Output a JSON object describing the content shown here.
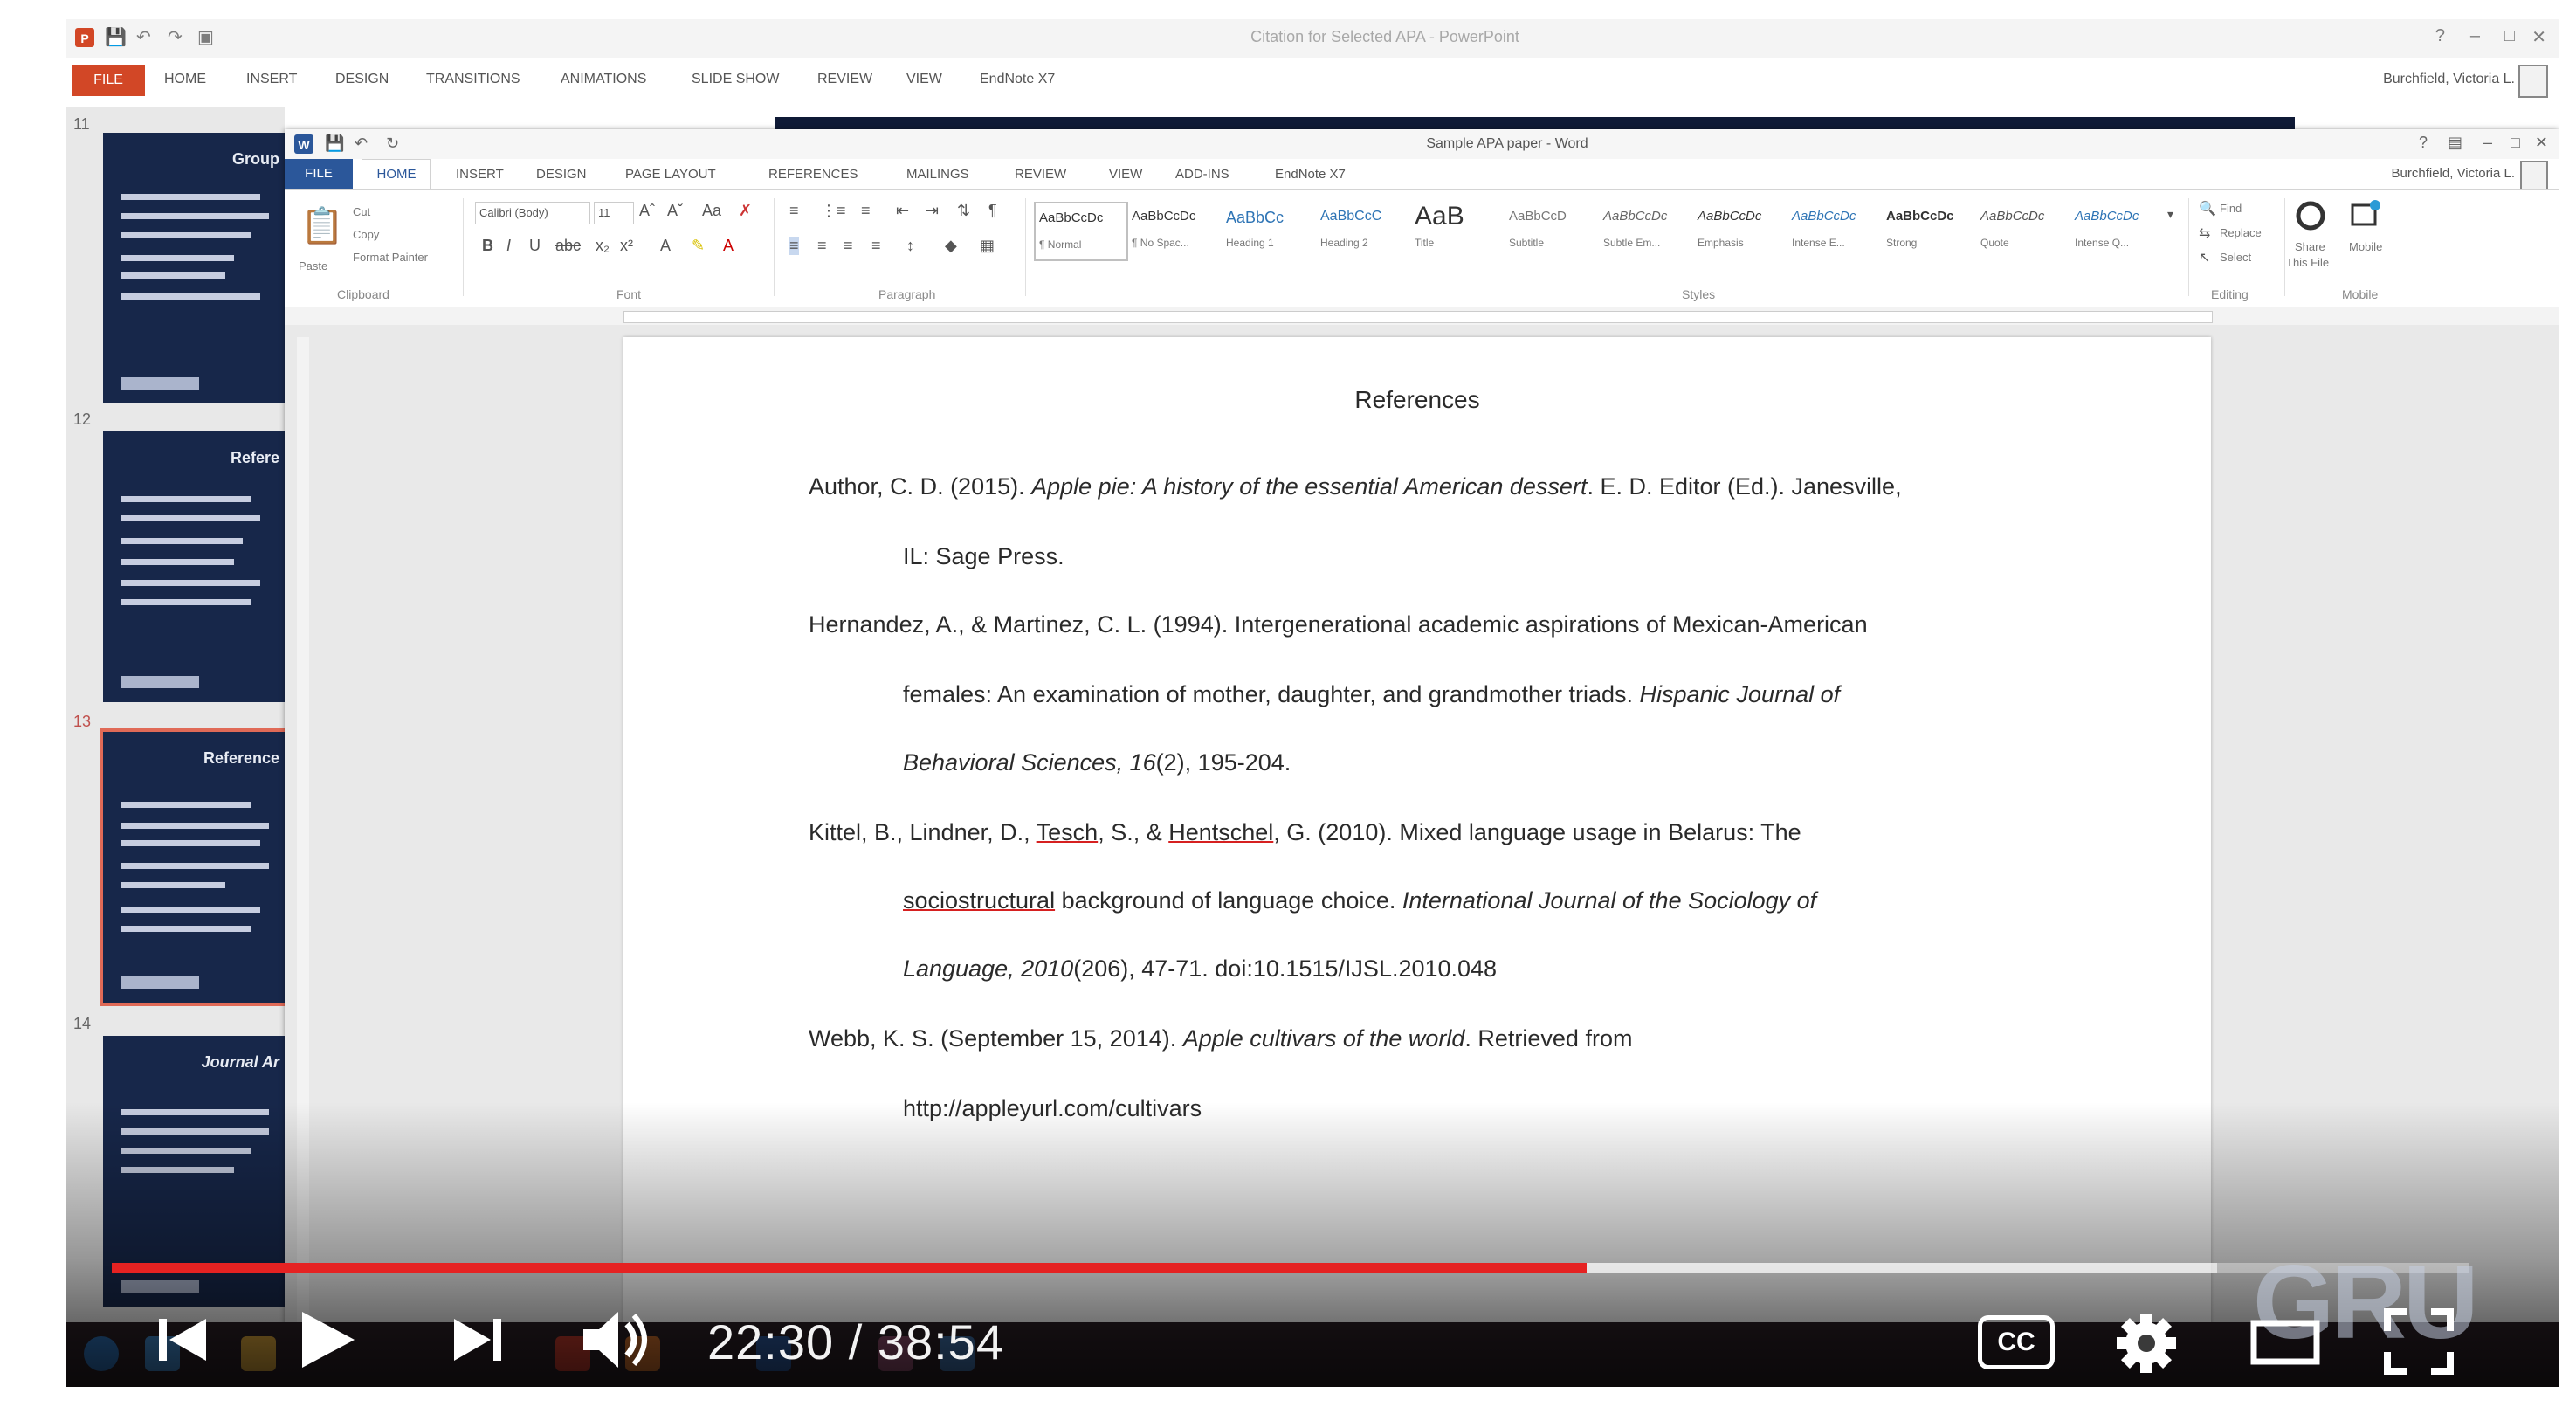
{
  "powerpoint": {
    "title_caption": "Citation for Selected APA - PowerPoint",
    "file_tab": "FILE",
    "tabs": [
      "HOME",
      "INSERT",
      "DESIGN",
      "TRANSITIONS",
      "ANIMATIONS",
      "SLIDE SHOW",
      "REVIEW",
      "VIEW",
      "EndNote X7"
    ],
    "user": "Burchfield, Victoria L.",
    "slides": [
      {
        "number": "11",
        "title": "Group"
      },
      {
        "number": "12",
        "title": "Refere"
      },
      {
        "number": "13",
        "title": "Reference"
      },
      {
        "number": "14",
        "title": "Journal Ar"
      }
    ]
  },
  "word": {
    "title_caption": "Sample APA paper - Word",
    "file_tab": "FILE",
    "tabs": [
      "HOME",
      "INSERT",
      "DESIGN",
      "PAGE LAYOUT",
      "REFERENCES",
      "MAILINGS",
      "REVIEW",
      "VIEW",
      "ADD-INS",
      "EndNote X7"
    ],
    "user": "Burchfield, Victoria L.",
    "ribbon": {
      "clipboard": {
        "label": "Clipboard",
        "cut": "Cut",
        "copy": "Copy",
        "format_painter": "Format Painter",
        "paste": "Paste"
      },
      "font": {
        "label": "Font",
        "font_name": "Calibri (Body)",
        "font_size": "11"
      },
      "paragraph": {
        "label": "Paragraph"
      },
      "styles": {
        "label": "Styles",
        "items": [
          {
            "sample": "AaBbCcDc",
            "name": "¶ Normal"
          },
          {
            "sample": "AaBbCcDc",
            "name": "¶ No Spac..."
          },
          {
            "sample": "AaBbCc",
            "name": "Heading 1"
          },
          {
            "sample": "AaBbCcC",
            "name": "Heading 2"
          },
          {
            "sample": "AaB",
            "name": "Title"
          },
          {
            "sample": "AaBbCcD",
            "name": "Subtitle"
          },
          {
            "sample": "AaBbCcDc",
            "name": "Subtle Em..."
          },
          {
            "sample": "AaBbCcDc",
            "name": "Emphasis"
          },
          {
            "sample": "AaBbCcDc",
            "name": "Intense E..."
          },
          {
            "sample": "AaBbCcDc",
            "name": "Strong"
          },
          {
            "sample": "AaBbCcDc",
            "name": "Quote"
          },
          {
            "sample": "AaBbCcDc",
            "name": "Intense Q..."
          }
        ]
      },
      "editing": {
        "label": "Editing",
        "find": "Find",
        "replace": "Replace",
        "select": "Select"
      },
      "mobile": {
        "label": "Mobile",
        "share": "Share",
        "share_file": "This File",
        "mobile": "Mobile"
      }
    },
    "document": {
      "heading": "References",
      "references": [
        {
          "line1": {
            "pre": "Author, C. D. (2015). ",
            "italic": "Apple pie: A history of the essential American dessert",
            "post": ". E. D. Editor (Ed.). Janesville,"
          },
          "line2": {
            "pre": "IL: Sage Press."
          }
        },
        {
          "line1": {
            "pre": "Hernandez, A., & Martinez, C. L. (1994). Intergenerational academic aspirations of Mexican-American"
          },
          "line2": {
            "pre": "females: An examination of mother, daughter, and grandmother triads. ",
            "italic": "Hispanic Journal of"
          },
          "line3": {
            "italic": "Behavioral Sciences, 16",
            "post": "(2), 195-204."
          }
        },
        {
          "line1": {
            "pre": "Kittel, B., Lindner, D., ",
            "spell1": "Tesch",
            "mid": ", S., & ",
            "spell2": "Hentschel",
            "post": ", G. (2010). Mixed language usage in Belarus: The"
          },
          "line2": {
            "spell1": "sociostructural",
            "pre": " background of language choice. ",
            "italic": "International Journal of the Sociology of"
          },
          "line3": {
            "italic": "Language, 2010",
            "post": "(206), 47-71. doi:10.1515/IJSL.2010.048"
          }
        },
        {
          "line1": {
            "pre": "Webb, K. S. (September 15, 2014). ",
            "italic": "Apple cultivars of the world",
            "post": ". Retrieved from"
          },
          "line2": {
            "pre": "http://appleyurl.com/cultivars"
          }
        }
      ]
    }
  },
  "player": {
    "time_current": "22:30",
    "time_separator": " / ",
    "time_total": "38:54",
    "progress_played_fraction": 0.6256,
    "progress_buffered_fraction": 0.893,
    "cc_label": "CC",
    "watermark": "GRU",
    "accent_color": "#e52222",
    "icons": [
      "previous-icon",
      "play-icon",
      "next-icon",
      "volume-icon",
      "cc-icon",
      "settings-gear-icon",
      "theater-mode-icon",
      "fullscreen-icon"
    ]
  }
}
